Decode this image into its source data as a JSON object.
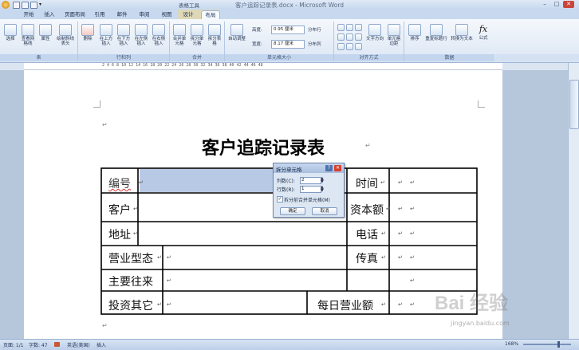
{
  "window": {
    "title": "客户追踪记录表.docx - Microsoft Word",
    "context_tab_group": "表格工具",
    "controls": [
      "–",
      "□",
      "✕"
    ]
  },
  "tabs": [
    "开始",
    "插入",
    "页面布局",
    "引用",
    "邮件",
    "审阅",
    "视图",
    "设计",
    "布局"
  ],
  "active_tab": "布局",
  "ribbon": {
    "groups": [
      {
        "name": "表",
        "buttons": [
          "选择",
          "查看网格线",
          "属性",
          "绘制斜线表头"
        ]
      },
      {
        "name": "行和列",
        "buttons": [
          "删除",
          "在上方插入",
          "在下方插入",
          "在左侧插入",
          "在右侧插入"
        ]
      },
      {
        "name": "合并",
        "buttons": [
          "合并单元格",
          "拆分单元格",
          "拆分表格"
        ]
      },
      {
        "name": "单元格大小",
        "buttons": [
          "自动调整"
        ],
        "height_label": "高度:",
        "height_value": "0.95 厘米",
        "width_label": "宽度:",
        "width_value": "8.17 厘米",
        "distribute_rows": "分布行",
        "distribute_cols": "分布列"
      },
      {
        "name": "对齐方式",
        "buttons": [
          "文字方向",
          "单元格边距"
        ]
      },
      {
        "name": "数据",
        "buttons": [
          "排序",
          "重复标题行",
          "转换为文本",
          "公式"
        ]
      }
    ]
  },
  "ruler": {
    "text": "2  4  6  8  10  12  14  16  18  20  22  24  26  28  30  32  34  36  38  40  42  44  46  48"
  },
  "document": {
    "paragraph_mark": "↵",
    "title": "客户追踪记录表",
    "table": {
      "cells": {
        "r1c1": "编号",
        "r1c3": "时间",
        "r2c1": "客户",
        "r2c3": "资本额",
        "r3c1": "地址",
        "r3c3": "电话",
        "r4c1": "营业型态",
        "r4c3": "传真",
        "r5c1": "主要往来",
        "r6c1": "投资其它",
        "r6c3": "每日营业额"
      }
    }
  },
  "dialog": {
    "title": "拆分单元格",
    "columns_label": "列数(C):",
    "columns_value": "2",
    "rows_label": "行数(R):",
    "rows_value": "1",
    "merge_label": "拆分前合并单元格(M)",
    "merge_checked": true,
    "ok_label": "确定",
    "cancel_label": "取消",
    "help_label": "?",
    "close_label": "✕"
  },
  "statusbar": {
    "page": "页面: 1/1",
    "words": "字数: 47",
    "language": "英语(美国)",
    "mode": "插入",
    "zoom": "168%"
  },
  "watermark": {
    "text": "Bai 经验",
    "url": "jingyan.baidu.com"
  },
  "colors": {
    "accent": "#c6d8ee",
    "selection": "#b8c9e6",
    "close_button": "#d9402f"
  }
}
